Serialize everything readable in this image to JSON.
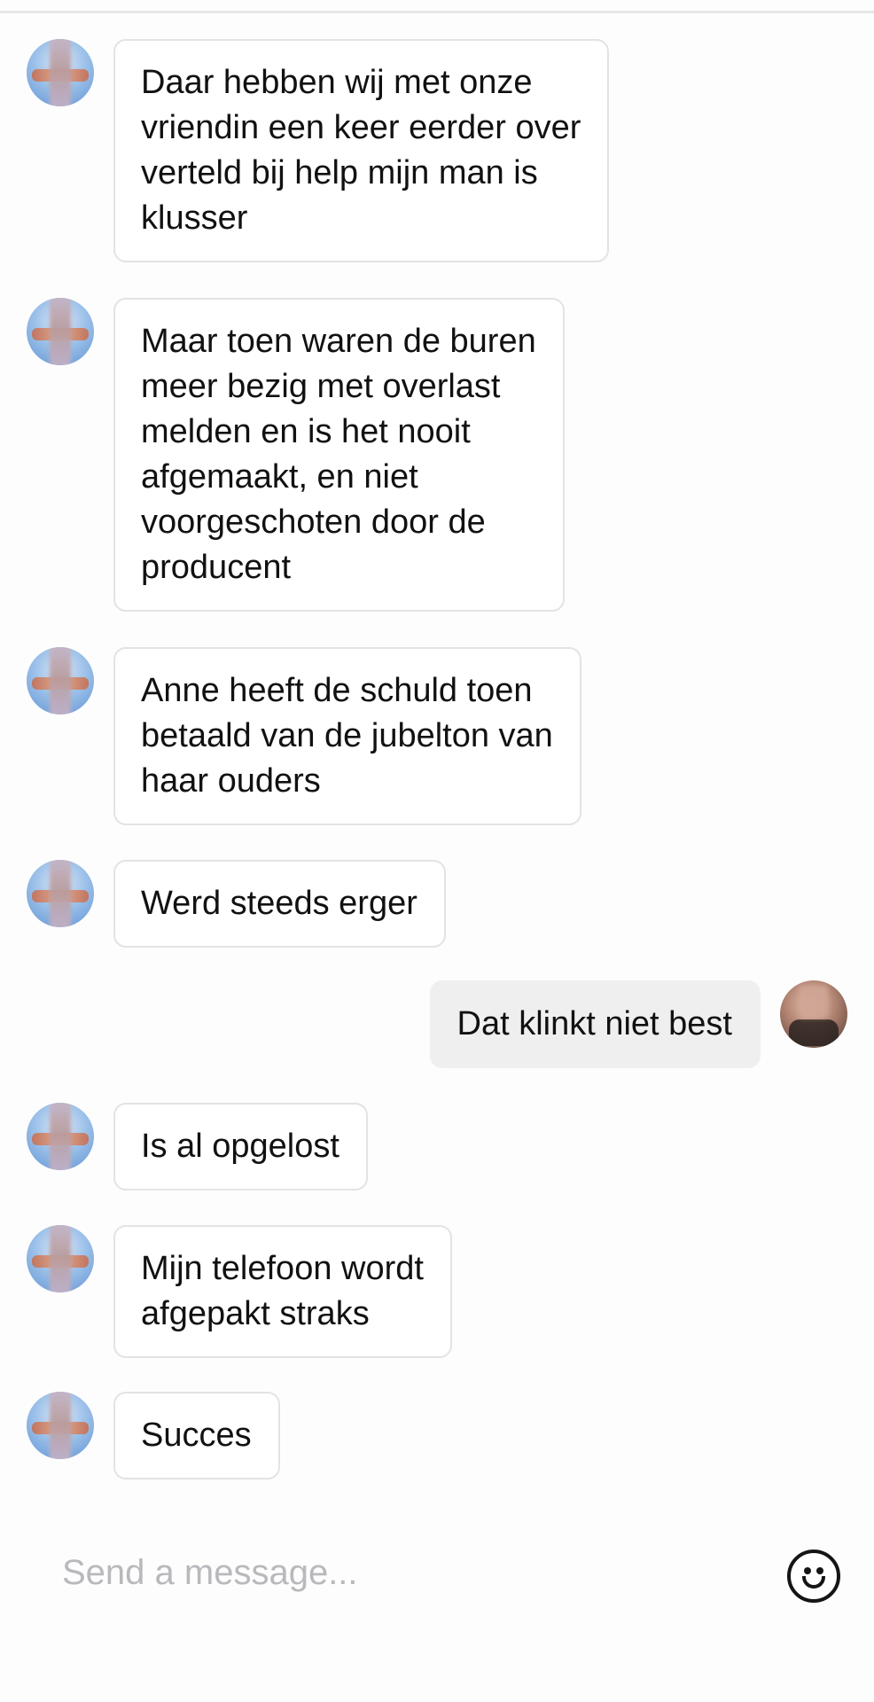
{
  "messages": [
    {
      "text": "Daar hebben wij met onze\nvriendin een keer eerder over\nverteld bij help mijn man is\nklusser"
    },
    {
      "text": "Maar toen waren de buren\nmeer bezig met overlast\nmelden en is het nooit\nafgemaakt, en niet\nvoorgeschoten door de\nproducent"
    },
    {
      "text": "Anne heeft de schuld toen\nbetaald van de jubelton van\nhaar ouders"
    },
    {
      "text": "Werd steeds erger"
    },
    {
      "text": "Dat klinkt niet best"
    },
    {
      "text": "Is al opgelost"
    },
    {
      "text": "Mijn telefoon wordt\nafgepakt straks"
    },
    {
      "text": "Succes"
    }
  ],
  "composer": {
    "placeholder": "Send a message...",
    "emoji_icon": "smiley-face-icon"
  }
}
